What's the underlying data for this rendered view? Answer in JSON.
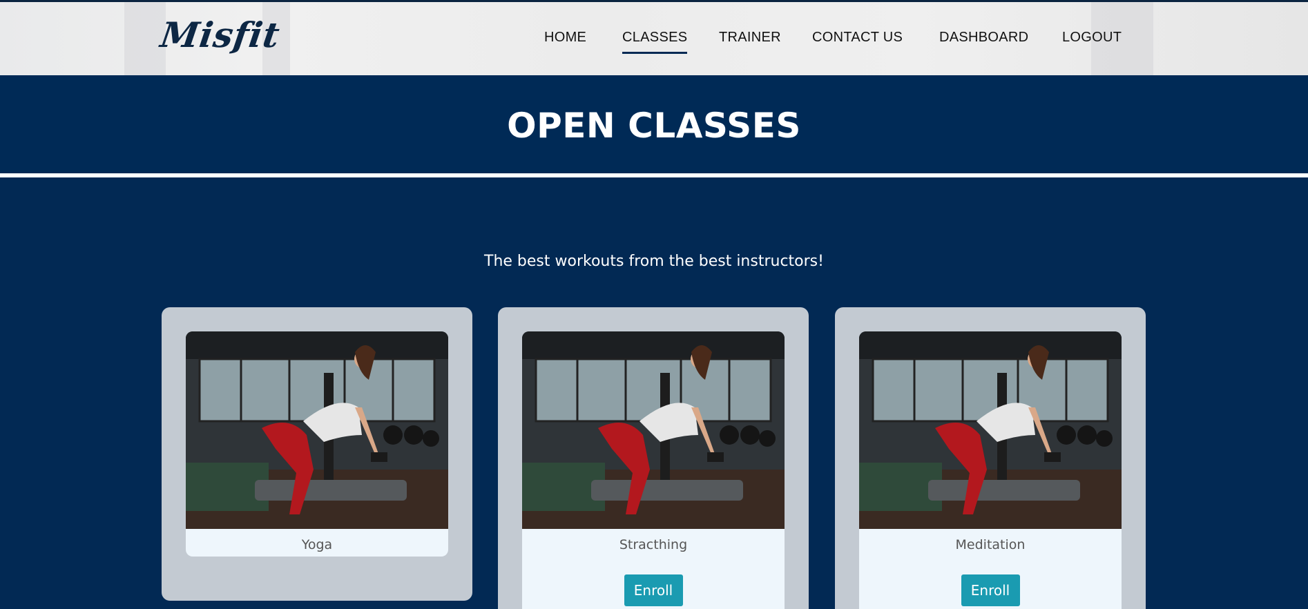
{
  "brand": {
    "logo_text": "Misfit"
  },
  "nav": {
    "items": [
      {
        "label": "HOME"
      },
      {
        "label": "CLASSES",
        "active": true
      },
      {
        "label": "TRAINER"
      },
      {
        "label": "CONTACT US"
      },
      {
        "label": "DASHBOARD"
      },
      {
        "label": "LOGOUT"
      }
    ]
  },
  "page": {
    "title": "OPEN CLASSES",
    "subtitle": "The best workouts from the best instructors!"
  },
  "classes": [
    {
      "name": "Yoga",
      "image": "gym-woman-dumbbell-row-photo"
    },
    {
      "name": "Stracthing",
      "image": "gym-woman-dumbbell-row-photo",
      "enroll_label": "Enroll"
    },
    {
      "name": "Meditation",
      "image": "gym-woman-dumbbell-row-photo",
      "enroll_label": "Enroll"
    }
  ],
  "colors": {
    "navy": "#022954",
    "banner": "#002a56",
    "card": "#c3cad2",
    "card_inner": "#eef6fc",
    "enroll": "#1a9bb1"
  }
}
